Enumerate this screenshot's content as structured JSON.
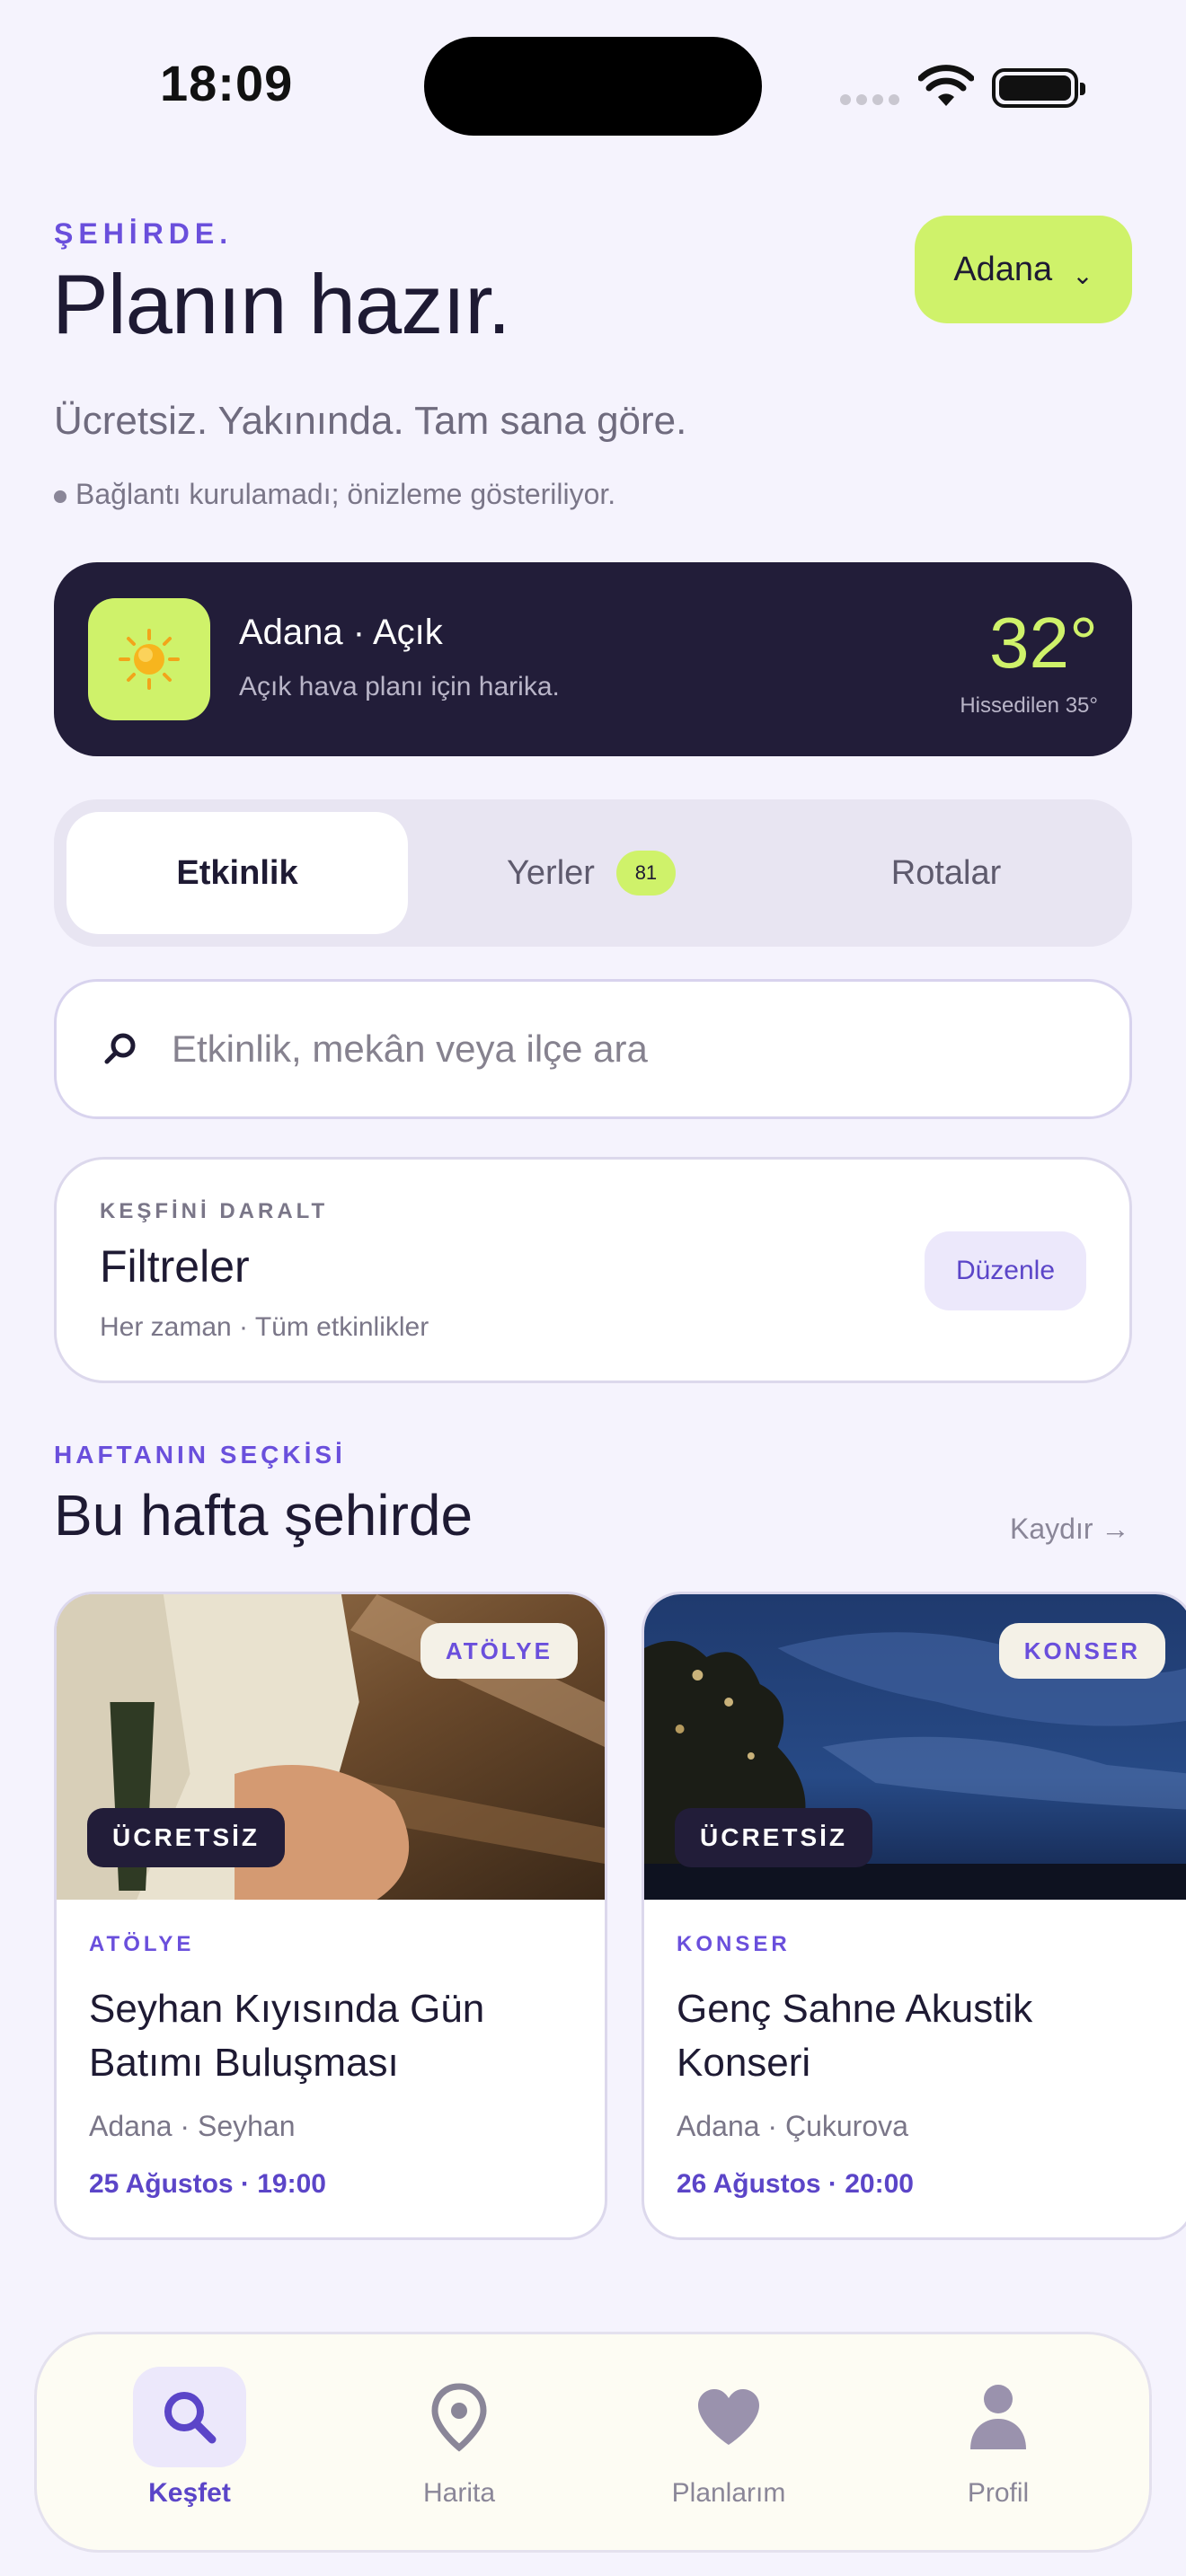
{
  "status_bar": {
    "time": "18:09"
  },
  "header": {
    "eyebrow": "ŞEHİRDE.",
    "title": "Planın hazır.",
    "city": "Adana",
    "subtitle": "Ücretsiz. Yakınında. Tam sana göre.",
    "notice": "Bağlantı kurulamadı; önizleme gösteriliyor."
  },
  "weather": {
    "icon": "sun-icon",
    "title": "Adana · Açık",
    "subtitle": "Açık hava planı için harika.",
    "temp": "32°",
    "feels_like": "Hissedilen 35°"
  },
  "segments": [
    {
      "label": "Etkinlik",
      "active": true
    },
    {
      "label": "Yerler",
      "badge": "81",
      "active": false
    },
    {
      "label": "Rotalar",
      "active": false
    }
  ],
  "search": {
    "placeholder": "Etkinlik, mekân veya ilçe ara",
    "value": ""
  },
  "filters": {
    "eyebrow": "KEŞFİNİ DARALT",
    "title": "Filtreler",
    "summary": "Her zaman · Tüm etkinlikler",
    "edit_label": "Düzenle"
  },
  "section": {
    "eyebrow": "HAFTANIN SEÇKİSİ",
    "title": "Bu hafta şehirde",
    "scroll_hint": "Kaydır →"
  },
  "cards": [
    {
      "category_badge": "ATÖLYE",
      "price_badge": "ÜCRETSİZ",
      "category": "ATÖLYE",
      "title": "Seyhan Kıyısında Gün Batımı Buluşması",
      "location": "Adana · Seyhan",
      "date": "25 Ağustos · 19:00"
    },
    {
      "category_badge": "KONSER",
      "price_badge": "ÜCRETSİZ",
      "category": "KONSER",
      "title": "Genç Sahne Akustik Konseri",
      "location": "Adana · Çukurova",
      "date": "26 Ağustos · 20:00"
    }
  ],
  "tabbar": [
    {
      "label": "Keşfet",
      "icon": "search-icon",
      "active": true
    },
    {
      "label": "Harita",
      "icon": "map-pin-icon",
      "active": false
    },
    {
      "label": "Planlarım",
      "icon": "heart-icon",
      "active": false
    },
    {
      "label": "Profil",
      "icon": "person-icon",
      "active": false
    }
  ],
  "colors": {
    "accent": "#6a4fdc",
    "lime": "#cff26a",
    "dark": "#221d39",
    "background": "#f5f3fd"
  }
}
